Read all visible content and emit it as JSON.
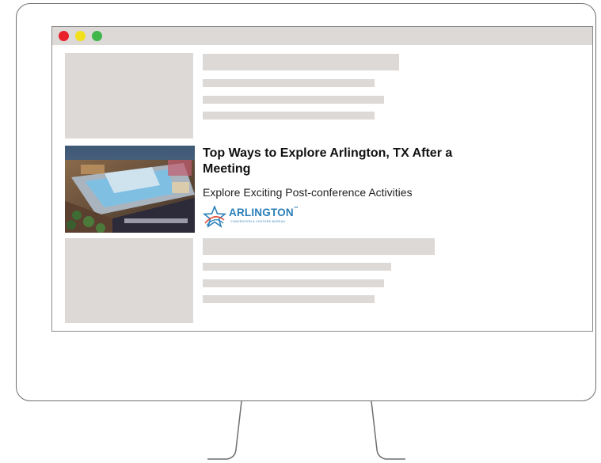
{
  "window": {
    "controls": [
      "close",
      "minimize",
      "maximize"
    ]
  },
  "ad": {
    "title": "Top Ways to Explore Arlington, TX After a Meeting",
    "subtitle": "Explore Exciting Post-conference Activities",
    "logo": {
      "name": "ARLINGTON",
      "tagline": "CONVENTION & VISITORS BUREAU"
    }
  },
  "colors": {
    "placeholder": "#dcd9d7",
    "close": "#e8212a",
    "minimize": "#f3e01c",
    "maximize": "#3fb64a",
    "brand": "#2b7fb8"
  }
}
